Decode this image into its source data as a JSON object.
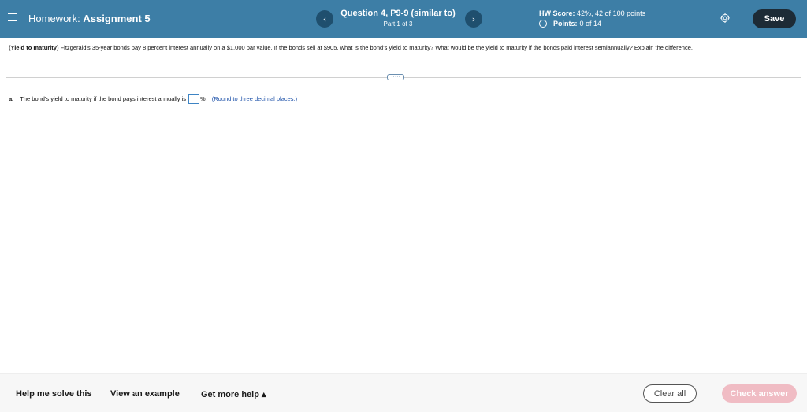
{
  "header": {
    "homework_prefix": "Homework:",
    "homework_name": "Assignment 5",
    "prev_symbol": "‹",
    "next_symbol": "›",
    "question_title": "Question 4, P9-9 (similar to)",
    "question_part": "Part 1 of 3",
    "hw_score_label": "HW Score:",
    "hw_score_value": "42%, 42 of 100 points",
    "points_label": "Points:",
    "points_value": "0 of 14",
    "save_label": "Save",
    "bg_color": "#3d7ea6"
  },
  "question": {
    "topic": "(Yield to maturity)",
    "text": "Fitzgerald's 35-year bonds pay 8 percent interest annually on a $1,000 par value.  If the bonds sell at $905, what is the bond's yield to maturity?  What would be the yield to maturity if the bonds paid interest semiannually? Explain the difference.",
    "more_symbol": "·····"
  },
  "part_a": {
    "label": "a.",
    "text": "The bond's yield to maturity if the bond pays interest annually is",
    "answer_value": "",
    "unit": "%.",
    "hint": "(Round to three decimal places.)"
  },
  "footer": {
    "help_label": "Help me solve this",
    "example_label": "View an example",
    "more_help_label": "Get more help ▴",
    "clear_label": "Clear all",
    "check_label": "Check answer",
    "check_color": "#f0bcc4"
  }
}
